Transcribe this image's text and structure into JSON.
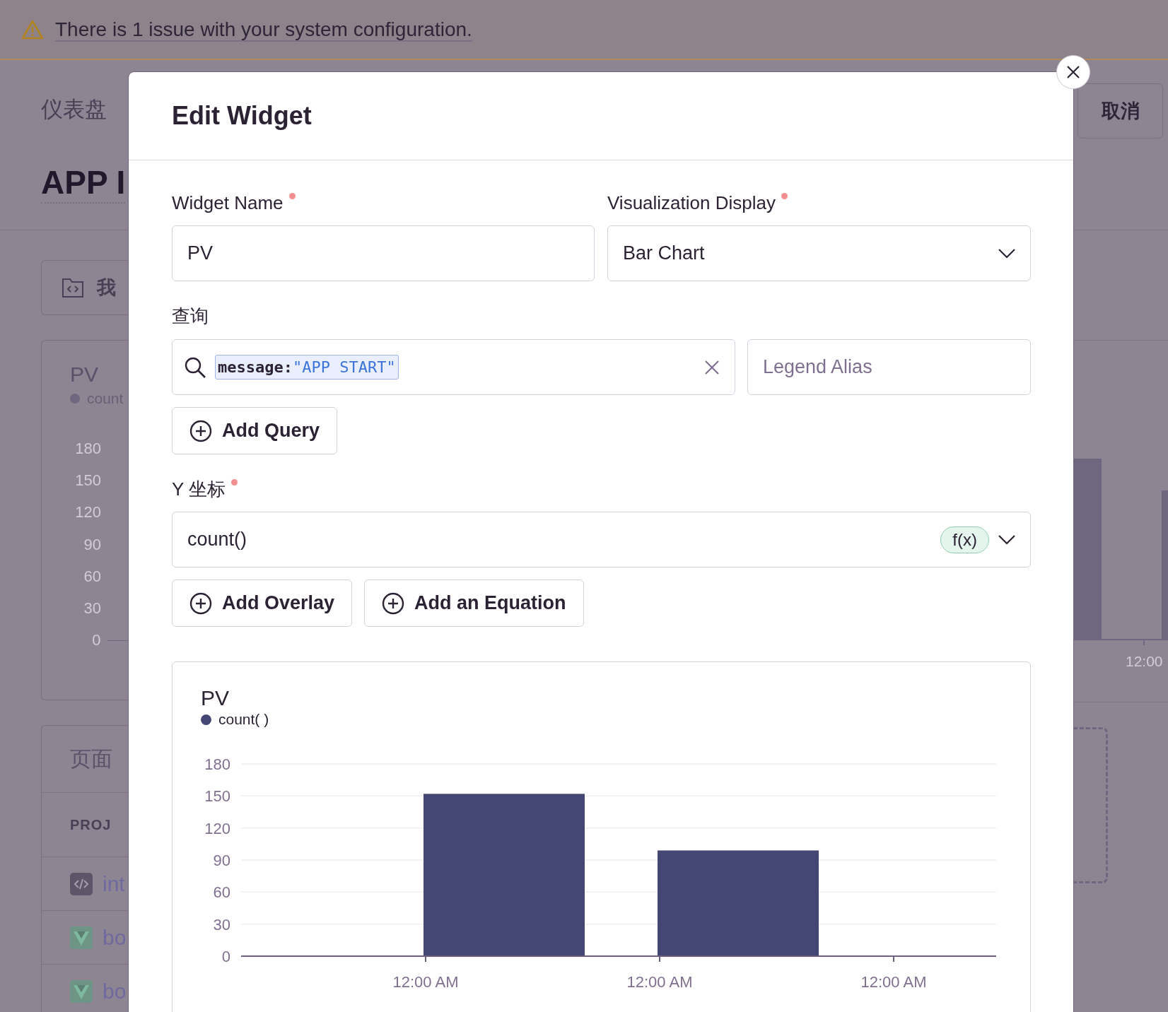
{
  "banner": {
    "text": "There is 1 issue with your system configuration."
  },
  "background": {
    "breadcrumb": "仪表盘",
    "title": "APP I",
    "folder_button": "我",
    "cancel_button": "取消",
    "widget": {
      "title": "PV",
      "legend": "count",
      "y_ticks": [
        "180",
        "150",
        "120",
        "90",
        "60",
        "30",
        "0"
      ],
      "x_label": "12:00"
    },
    "table": {
      "title": "页面",
      "column_1": "PROJ",
      "rows": [
        {
          "kind": "code",
          "label": "int"
        },
        {
          "kind": "vue",
          "label": "bo"
        },
        {
          "kind": "vue",
          "label": "bo"
        }
      ]
    }
  },
  "modal": {
    "title": "Edit Widget",
    "widget_name": {
      "label": "Widget Name",
      "required": true,
      "value": "PV"
    },
    "visualization_display": {
      "label": "Visualization Display",
      "required": true,
      "value": "Bar Chart"
    },
    "query_label": "查询",
    "query": {
      "token_key": "message:",
      "token_value": "\"APP START\"",
      "legend_placeholder": "Legend Alias"
    },
    "add_query_button": "Add Query",
    "y_axis": {
      "label": "Y 坐标",
      "required": true,
      "value": "count()",
      "function_badge": "f(x)"
    },
    "buttons": [
      "Add Overlay",
      "Add an Equation"
    ],
    "chart": {
      "chart_data": {
        "type": "bar",
        "title": "PV",
        "categories": [
          "12:00 AM",
          "12:00 AM",
          "12:00 AM"
        ],
        "series": [
          {
            "name": "count( )",
            "color": "#444674",
            "values": [
              152,
              99,
              0
            ]
          }
        ],
        "grid": true,
        "ylim": [
          0,
          180
        ],
        "yticks": [
          0,
          30,
          60,
          90,
          120,
          150,
          180
        ]
      }
    }
  }
}
